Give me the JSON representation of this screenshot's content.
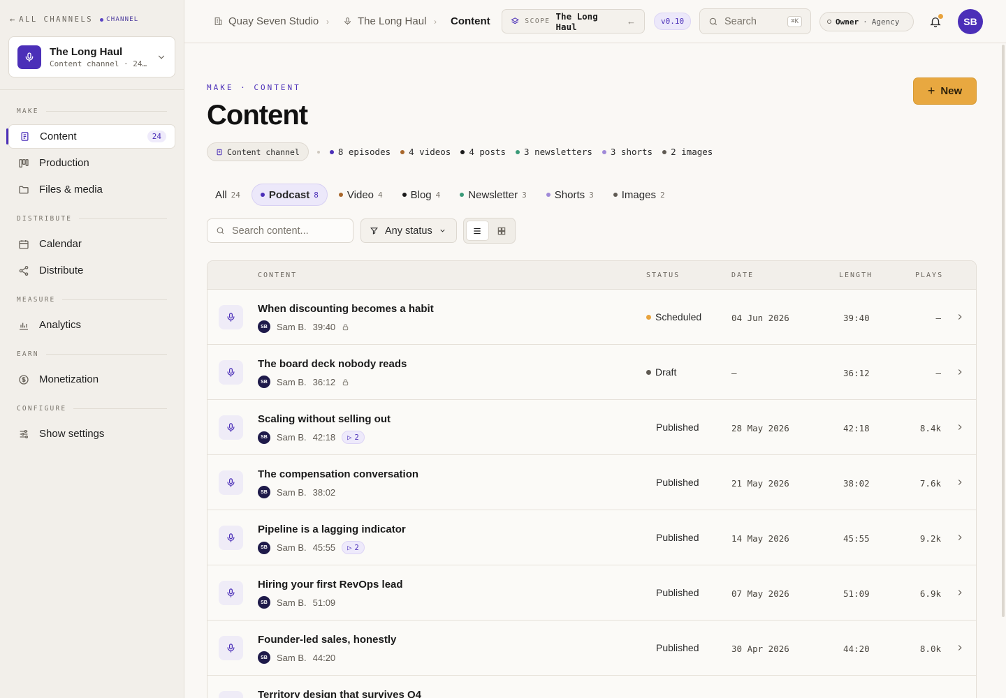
{
  "sidebar": {
    "back_label": "ALL CHANNELS",
    "channel_tag": "CHANNEL",
    "channel": {
      "name": "The Long Haul",
      "subtitle": "Content channel · 24…"
    },
    "sections": [
      {
        "label": "MAKE"
      },
      {
        "label": "DISTRIBUTE"
      },
      {
        "label": "MEASURE"
      },
      {
        "label": "EARN"
      },
      {
        "label": "CONFIGURE"
      }
    ],
    "items": [
      {
        "label": "Content",
        "count": "24",
        "icon": "document-icon",
        "active": true
      },
      {
        "label": "Production",
        "icon": "kanban-icon"
      },
      {
        "label": "Files & media",
        "icon": "folder-icon"
      },
      {
        "label": "Calendar",
        "icon": "calendar-icon"
      },
      {
        "label": "Distribute",
        "icon": "share-icon"
      },
      {
        "label": "Analytics",
        "icon": "bar-chart-icon"
      },
      {
        "label": "Monetization",
        "icon": "dollar-icon"
      },
      {
        "label": "Show settings",
        "icon": "sliders-icon"
      }
    ]
  },
  "topbar": {
    "breadcrumbs": [
      {
        "label": "Quay Seven Studio",
        "icon": "building-icon"
      },
      {
        "label": "The Long Haul",
        "icon": "mic-icon"
      },
      {
        "label": "Content"
      }
    ],
    "scope": {
      "label": "SCOPE",
      "value": "The Long Haul"
    },
    "version": "v0.10",
    "search": {
      "placeholder": "Search",
      "shortcut": "⌘K"
    },
    "role": {
      "role": "Owner",
      "org": "Agency"
    },
    "avatar": "SB"
  },
  "page": {
    "eyebrow": "MAKE · CONTENT",
    "title": "Content",
    "new_button": "New",
    "summary": {
      "chip": "Content channel",
      "items": [
        {
          "label": "8 episodes",
          "color": "#4b2fb8"
        },
        {
          "label": "4 videos",
          "color": "#a8672b"
        },
        {
          "label": "4 posts",
          "color": "#1a1a1a"
        },
        {
          "label": "3 newsletters",
          "color": "#3a9a78"
        },
        {
          "label": "3 shorts",
          "color": "#a08ad8"
        },
        {
          "label": "2 images",
          "color": "#5f5a52"
        }
      ]
    },
    "tabs": [
      {
        "label": "All",
        "count": "24"
      },
      {
        "label": "Podcast",
        "count": "8",
        "color": "#4b2fb8",
        "active": true
      },
      {
        "label": "Video",
        "count": "4",
        "color": "#a8672b"
      },
      {
        "label": "Blog",
        "count": "4",
        "color": "#1a1a1a"
      },
      {
        "label": "Newsletter",
        "count": "3",
        "color": "#3a9a78"
      },
      {
        "label": "Shorts",
        "count": "3",
        "color": "#a08ad8"
      },
      {
        "label": "Images",
        "count": "2",
        "color": "#5f5a52"
      }
    ],
    "content_search_placeholder": "Search content...",
    "status_filter": "Any status"
  },
  "table": {
    "headers": {
      "content": "CONTENT",
      "status": "STATUS",
      "date": "DATE",
      "length": "LENGTH",
      "plays": "PLAYS"
    },
    "rows": [
      {
        "title": "When discounting becomes a habit",
        "author": "Sam B.",
        "initials": "SB",
        "duration": "39:40",
        "locked": true,
        "status": "Scheduled",
        "status_color": "#e8a33d",
        "date": "04 Jun 2026",
        "length": "39:40",
        "plays": "—"
      },
      {
        "title": "The board deck nobody reads",
        "author": "Sam B.",
        "initials": "SB",
        "duration": "36:12",
        "locked": true,
        "status": "Draft",
        "status_color": "#5f5a52",
        "date": "—",
        "length": "36:12",
        "plays": "—"
      },
      {
        "title": "Scaling without selling out",
        "author": "Sam B.",
        "initials": "SB",
        "duration": "42:18",
        "clips": "2",
        "status": "Published",
        "date": "28 May 2026",
        "length": "42:18",
        "plays": "8.4k"
      },
      {
        "title": "The compensation conversation",
        "author": "Sam B.",
        "initials": "SB",
        "duration": "38:02",
        "status": "Published",
        "date": "21 May 2026",
        "length": "38:02",
        "plays": "7.6k"
      },
      {
        "title": "Pipeline is a lagging indicator",
        "author": "Sam B.",
        "initials": "SB",
        "duration": "45:55",
        "clips": "2",
        "status": "Published",
        "date": "14 May 2026",
        "length": "45:55",
        "plays": "9.2k"
      },
      {
        "title": "Hiring your first RevOps lead",
        "author": "Sam B.",
        "initials": "SB",
        "duration": "51:09",
        "status": "Published",
        "date": "07 May 2026",
        "length": "51:09",
        "plays": "6.9k"
      },
      {
        "title": "Founder-led sales, honestly",
        "author": "Sam B.",
        "initials": "SB",
        "duration": "44:20",
        "status": "Published",
        "date": "30 Apr 2026",
        "length": "44:20",
        "plays": "8.0k"
      },
      {
        "title": "Territory design that survives Q4"
      }
    ]
  }
}
